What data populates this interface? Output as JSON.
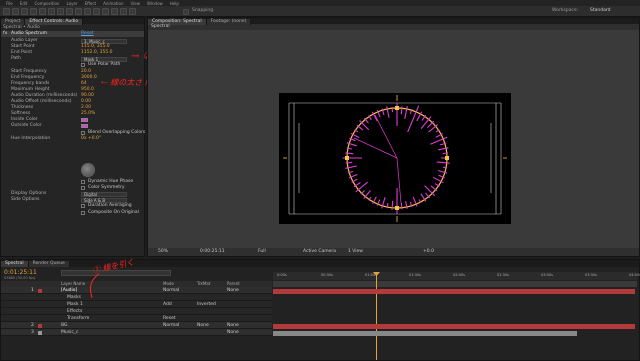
{
  "menu": [
    "File",
    "Edit",
    "Composition",
    "Layer",
    "Effect",
    "Animation",
    "View",
    "Window",
    "Help"
  ],
  "toolbar": {
    "snapping_label": "Snapping",
    "workspace_label": "Workspace:",
    "workspace_value": "Standard"
  },
  "left_panel": {
    "tabs": [
      "Project",
      "Effect Controls: Audio"
    ],
    "breadcrumb": "Spectral • Audio",
    "effect_name": "Audio Spectrum",
    "reset_label": "Reset",
    "properties": [
      {
        "label": "Audio Layer",
        "value": "3. Music_c",
        "kind": "dropdown"
      },
      {
        "label": "Start Point",
        "value": "115.0, 355.0",
        "kind": "value"
      },
      {
        "label": "End Point",
        "value": "1152.0, 355.0",
        "kind": "value"
      },
      {
        "label": "Path",
        "value": "Mask 1",
        "kind": "dropdown"
      },
      {
        "label": "",
        "value": "Use Polar Path",
        "kind": "check"
      },
      {
        "label": "Start Frequency",
        "value": "20.0",
        "kind": "value"
      },
      {
        "label": "End Frequency",
        "value": "3000.0",
        "kind": "value"
      },
      {
        "label": "Frequency bands",
        "value": "64",
        "kind": "value"
      },
      {
        "label": "Maximum Height",
        "value": "950.0",
        "kind": "value"
      },
      {
        "label": "Audio Duration (milliseconds)",
        "value": "90.00",
        "kind": "value"
      },
      {
        "label": "Audio Offset (milliseconds)",
        "value": "0.00",
        "kind": "value"
      },
      {
        "label": "Thickness",
        "value": "2.00",
        "kind": "value"
      },
      {
        "label": "Softness",
        "value": "25.0%",
        "kind": "value"
      },
      {
        "label": "Inside Color",
        "value": "",
        "kind": "color"
      },
      {
        "label": "Outside Color",
        "value": "",
        "kind": "color"
      },
      {
        "label": "",
        "value": "Blend Overlapping Colors",
        "kind": "check"
      },
      {
        "label": "Hue Interpolation",
        "value": "0x +0.0°",
        "kind": "value"
      }
    ],
    "more_properties": [
      {
        "label": "",
        "value": "Dynamic Hue Phase",
        "kind": "check"
      },
      {
        "label": "",
        "value": "Color Symmetry",
        "kind": "check"
      },
      {
        "label": "Display Options",
        "value": "Digital",
        "kind": "dropdown"
      },
      {
        "label": "Side Options",
        "value": "Side A & B",
        "kind": "dropdown"
      },
      {
        "label": "",
        "value": "Duration Averaging",
        "kind": "check"
      },
      {
        "label": "",
        "value": "Composite On Original",
        "kind": "check"
      }
    ]
  },
  "comp_panel": {
    "tabs": [
      "Composition: Spectral",
      "Footage: (none)"
    ],
    "subtab": "Spectral",
    "footer": {
      "zoom": "50%",
      "timecode": "0:00:25:11",
      "resolution": "Full",
      "camera": "Active Camera",
      "views": "1 View",
      "exposure": "+0.0"
    }
  },
  "timeline": {
    "tabs": [
      "Spectral",
      "Render Queue"
    ],
    "timecode": "0:01:25:11",
    "frame_info": "03685 (30.00 fps)",
    "columns": {
      "source": "Layer Name",
      "mode": "Mode",
      "trkmat": "TrkMat",
      "parent": "Parent"
    },
    "ruler": [
      "0:00s",
      "00:30s",
      "01:00s",
      "01:30s",
      "02:00s",
      "02:30s",
      "03:00s",
      "03:30s",
      "04:00s"
    ],
    "layers": [
      {
        "num": "1",
        "name": "[Audio]",
        "mode": "Normal",
        "trkmat": "",
        "parent": "None"
      },
      {
        "num": "",
        "name": "Masks",
        "mode": "",
        "trkmat": "",
        "parent": ""
      },
      {
        "num": "",
        "name": "Mask 1",
        "mode": "Add",
        "trkmat": "Inverted",
        "parent": ""
      },
      {
        "num": "",
        "name": "Effects",
        "mode": "",
        "trkmat": "",
        "parent": ""
      },
      {
        "num": "",
        "name": "Transform",
        "mode": "Reset",
        "trkmat": "",
        "parent": ""
      },
      {
        "num": "2",
        "name": "BG",
        "mode": "Normal",
        "trkmat": "None",
        "parent": "None"
      },
      {
        "num": "3",
        "name": "Music_c",
        "mode": "",
        "trkmat": "",
        "parent": "None"
      }
    ]
  },
  "annotations": {
    "arrow_top": "→ ②",
    "arrow_mid": "⇠ 線の太さ 同形大",
    "arrow_bottom": "① 線を引く"
  },
  "colors": {
    "accent": "#e6a23a",
    "magenta": "#e23bd6",
    "yellow": "#f5c542",
    "red_bar": "#b23a3a",
    "annotation": "#ff2222"
  }
}
